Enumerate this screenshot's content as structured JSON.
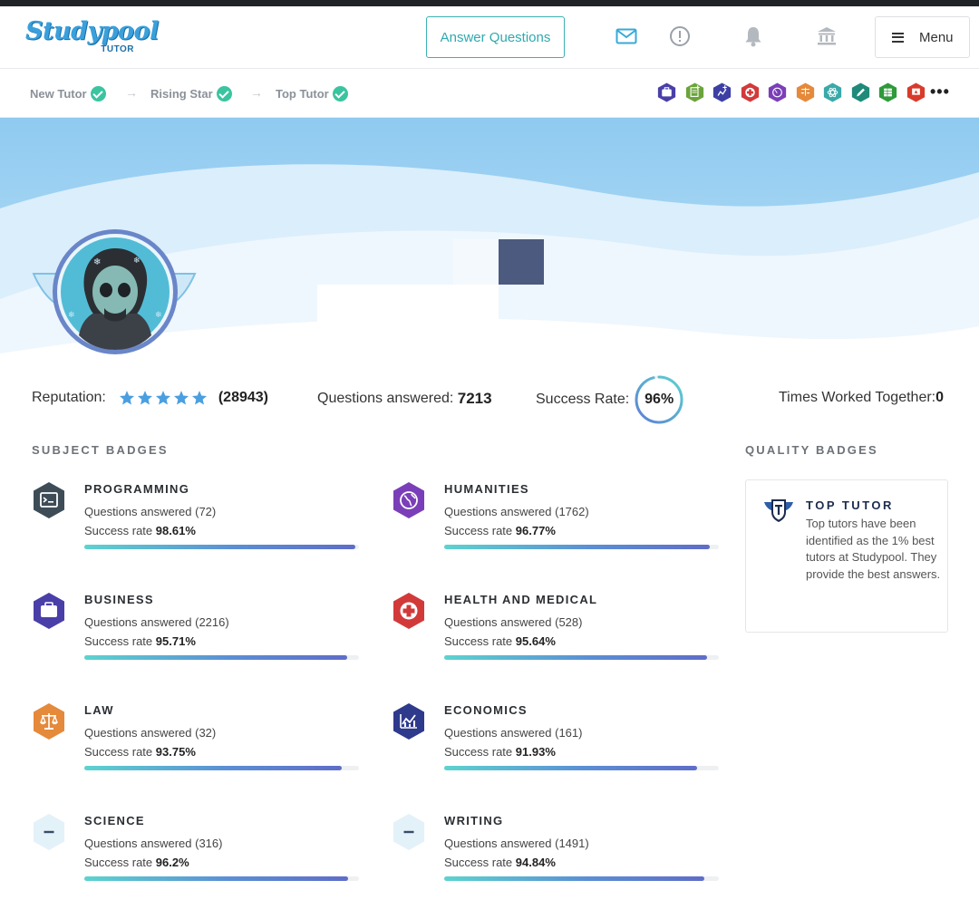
{
  "header": {
    "logo_text": "Studypool",
    "logo_sub": "TUTOR",
    "answer_button": "Answer Questions",
    "menu_label": "Menu"
  },
  "progress": {
    "steps": [
      "New Tutor",
      "Rising Star",
      "Top Tutor"
    ]
  },
  "mini_badges": [
    {
      "icon": "briefcase-icon",
      "color": "#4a3fa8"
    },
    {
      "icon": "document-plus-icon",
      "color": "#6aa43a"
    },
    {
      "icon": "chart-plus-icon",
      "color": "#3d3fa4"
    },
    {
      "icon": "medical-cross-icon",
      "color": "#d23a3a"
    },
    {
      "icon": "globe-icon",
      "color": "#7a3fb8"
    },
    {
      "icon": "scales-icon",
      "color": "#e5893a"
    },
    {
      "icon": "atom-icon",
      "color": "#3aa9a9"
    },
    {
      "icon": "pencil-icon",
      "color": "#1f8a7a"
    },
    {
      "icon": "spreadsheet-icon",
      "color": "#2e9a3a"
    },
    {
      "icon": "presentation-icon",
      "color": "#d83b2a"
    }
  ],
  "stats": {
    "reputation_label": "Reputation:",
    "reputation_count": "(28943)",
    "questions_label": "Questions answered:",
    "questions_value": "7213",
    "success_label": "Success Rate:",
    "success_value": "96%",
    "success_fraction": 0.96,
    "worked_label": "Times Worked Together:",
    "worked_value": "0"
  },
  "sections": {
    "subject_title": "SUBJECT BADGES",
    "quality_title": "QUALITY BADGES"
  },
  "subjects": [
    {
      "name": "PROGRAMMING",
      "questions": "Questions answered (72)",
      "rate_label": "Success rate",
      "rate": "98.61%",
      "fraction": 0.9861,
      "icon": "terminal-icon",
      "color": "#3e4c57"
    },
    {
      "name": "HUMANITIES",
      "questions": "Questions answered (1762)",
      "rate_label": "Success rate",
      "rate": "96.77%",
      "fraction": 0.9677,
      "icon": "globe-icon",
      "color": "#7a3fb8"
    },
    {
      "name": "BUSINESS",
      "questions": "Questions answered (2216)",
      "rate_label": "Success rate",
      "rate": "95.71%",
      "fraction": 0.9571,
      "icon": "briefcase-icon",
      "color": "#4a3fa8"
    },
    {
      "name": "HEALTH AND MEDICAL",
      "questions": "Questions answered (528)",
      "rate_label": "Success rate",
      "rate": "95.64%",
      "fraction": 0.9564,
      "icon": "medical-cross-icon",
      "color": "#d23a3a"
    },
    {
      "name": "LAW",
      "questions": "Questions answered (32)",
      "rate_label": "Success rate",
      "rate": "93.75%",
      "fraction": 0.9375,
      "icon": "scales-icon",
      "color": "#e5893a"
    },
    {
      "name": "ECONOMICS",
      "questions": "Questions answered (161)",
      "rate_label": "Success rate",
      "rate": "91.93%",
      "fraction": 0.9193,
      "icon": "chart-icon",
      "color": "#2e3a8c"
    },
    {
      "name": "SCIENCE",
      "questions": "Questions answered (316)",
      "rate_label": "Success rate",
      "rate": "96.2%",
      "fraction": 0.962,
      "icon": "minus-icon",
      "color": "#e3f1f9"
    },
    {
      "name": "WRITING",
      "questions": "Questions answered (1491)",
      "rate_label": "Success rate",
      "rate": "94.84%",
      "fraction": 0.9484,
      "icon": "minus-icon",
      "color": "#e3f1f9"
    }
  ],
  "quality": {
    "title": "TOP TUTOR",
    "text": "Top tutors have been identified as the 1% best tutors at Studypool. They provide the best answers."
  },
  "colors": {
    "accent": "#3cb1b4",
    "star": "#4a9fe0",
    "check": "#3ac4a0"
  }
}
